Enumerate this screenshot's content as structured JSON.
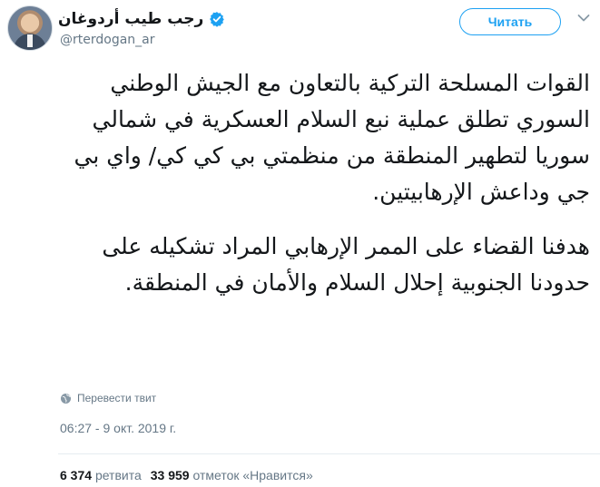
{
  "author": {
    "name": "رجب طيب أردوغان",
    "handle": "@rterdogan_ar"
  },
  "follow_button": {
    "label": "Читать"
  },
  "tweet": {
    "paragraph1": "القوات المسلحة التركية بالتعاون مع الجيش الوطني السوري تطلق عملية نبع السلام العسكرية في شمالي سوريا لتطهير المنطقة من منظمتي بي كي كي/ واي بي جي وداعش الإرهابيتين.",
    "paragraph2": "هدفنا القضاء على الممر الإرهابي المراد تشكيله على حدودنا الجنوبية إحلال السلام والأمان في المنطقة."
  },
  "translate_link": "Перевести твит",
  "timestamp": "06:27 - 9 окт. 2019 г.",
  "stats": {
    "retweets_count": "6 374",
    "retweets_label": "ретвита",
    "likes_count": "33 959",
    "likes_label": "отметок «Нравится»"
  },
  "colors": {
    "accent": "#1da1f2",
    "muted": "#657786",
    "text": "#14171a"
  },
  "icons": {
    "verified": "verified-badge-icon",
    "globe": "globe-icon",
    "chevron": "chevron-down-icon"
  }
}
